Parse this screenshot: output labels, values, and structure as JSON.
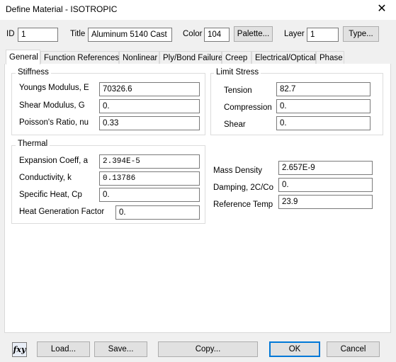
{
  "window": {
    "title": "Define Material - ISOTROPIC",
    "close_glyph": "✕"
  },
  "header": {
    "id_label": "ID",
    "id_value": "1",
    "title_label": "Title",
    "title_value": "Aluminum 5140 Cast",
    "color_label": "Color",
    "color_value": "104",
    "palette_button": "Palette...",
    "layer_label": "Layer",
    "layer_value": "1",
    "type_button": "Type..."
  },
  "tabs": [
    "General",
    "Function References",
    "Nonlinear",
    "Ply/Bond Failure",
    "Creep",
    "Electrical/Optical",
    "Phase"
  ],
  "stiffness": {
    "title": "Stiffness",
    "youngs_label": "Youngs Modulus, E",
    "youngs_value": "70326.6",
    "shear_label": "Shear Modulus, G",
    "shear_value": "0.",
    "poisson_label": "Poisson's Ratio, nu",
    "poisson_value": "0.33"
  },
  "limit_stress": {
    "title": "Limit Stress",
    "tension_label": "Tension",
    "tension_value": "82.7",
    "compression_label": "Compression",
    "compression_value": "0.",
    "shear_label": "Shear",
    "shear_value": "0."
  },
  "thermal": {
    "title": "Thermal",
    "expansion_label": "Expansion Coeff, a",
    "expansion_value": "2.394E-5",
    "conductivity_label": "Conductivity, k",
    "conductivity_value": "0.13786",
    "specific_heat_label": "Specific Heat, Cp",
    "specific_heat_value": "0.",
    "heat_gen_label": "Heat Generation Factor",
    "heat_gen_value": "0."
  },
  "other": {
    "mass_density_label": "Mass Density",
    "mass_density_value": "2.657E-9",
    "damping_label": "Damping, 2C/Co",
    "damping_value": "0.",
    "ref_temp_label": "Reference Temp",
    "ref_temp_value": "23.9"
  },
  "footer": {
    "fxy_icon_text": "fxy",
    "load_button": "Load...",
    "save_button": "Save...",
    "copy_button": "Copy...",
    "ok_button": "OK",
    "cancel_button": "Cancel"
  }
}
